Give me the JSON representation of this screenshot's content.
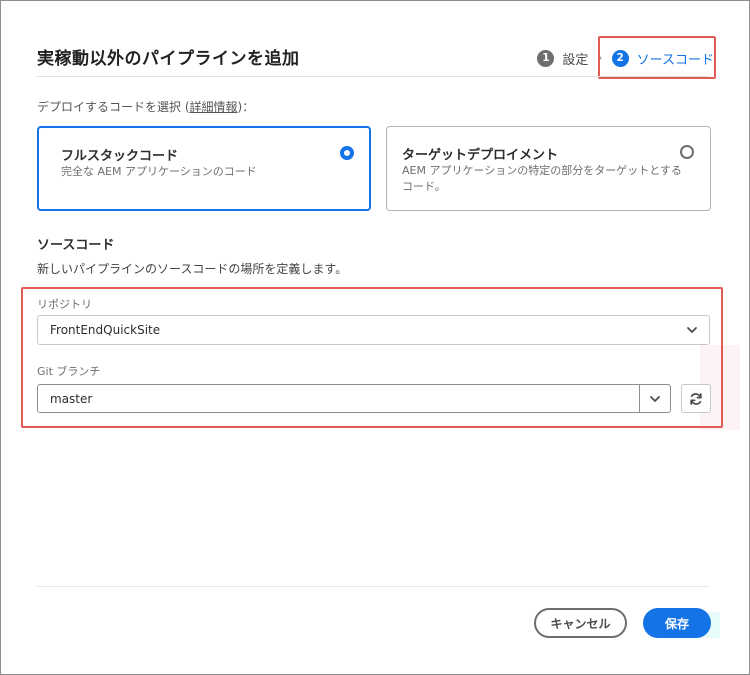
{
  "dialog": {
    "title": "実稼動以外のパイプラインを追加"
  },
  "steps": [
    {
      "num": "1",
      "label": "設定",
      "state": "done"
    },
    {
      "num": "2",
      "label": "ソースコード",
      "state": "active"
    }
  ],
  "deploy": {
    "prefix": "デプロイするコードを選択 (",
    "link": "詳細情報",
    "suffix": ")："
  },
  "cards": [
    {
      "title": "フルスタックコード",
      "desc": "完全な AEM アプリケーションのコード",
      "selected": true
    },
    {
      "title": "ターゲットデプロイメント",
      "desc": "AEM アプリケーションの特定の部分をターゲットとするコード。",
      "selected": false
    }
  ],
  "source": {
    "heading": "ソースコード",
    "description": "新しいパイプラインのソースコードの場所を定義します。"
  },
  "repository": {
    "label": "リポジトリ",
    "value": "FrontEndQuickSite"
  },
  "git_branch": {
    "label": "Git ブランチ",
    "value": "master"
  },
  "buttons": {
    "cancel": "キャンセル",
    "save": "保存"
  },
  "colors": {
    "accent": "#1473e6",
    "highlight": "#e25a54"
  },
  "icons": {
    "chevron": "chevron-down-icon",
    "refresh": "refresh-icon",
    "radio_on": "radio-selected-icon",
    "radio_off": "radio-unselected-icon"
  }
}
